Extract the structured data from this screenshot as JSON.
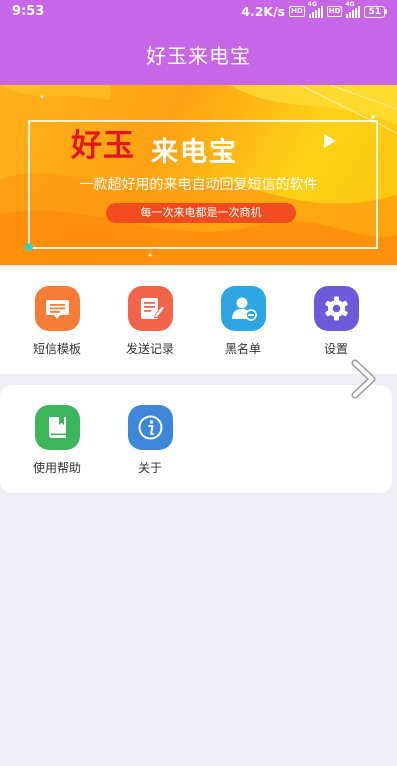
{
  "status_bar": {
    "time": "9:53",
    "net_speed": "4.2K/s",
    "hd_tag": "HD",
    "network_gen": "4G",
    "battery_level": "51"
  },
  "app_bar": {
    "title": "好玉来电宝"
  },
  "banner": {
    "title_part1": "好玉",
    "title_part2": "来电宝",
    "subtitle": "一款超好用的来电自动回复短信的软件",
    "slogan": "每一次来电都是一次商机"
  },
  "menu_primary": [
    {
      "label": "短信模板",
      "icon": "sms-template-icon",
      "color": "#f57c36"
    },
    {
      "label": "发送记录",
      "icon": "send-record-icon",
      "color": "#f2644a"
    },
    {
      "label": "黑名单",
      "icon": "blacklist-icon",
      "color": "#2ea6e4"
    },
    {
      "label": "设置",
      "icon": "gear-icon",
      "color": "#6b5bd9"
    }
  ],
  "menu_secondary": [
    {
      "label": "使用帮助",
      "icon": "help-book-icon",
      "color": "#3db55c"
    },
    {
      "label": "关于",
      "icon": "info-icon",
      "color": "#3e86d8"
    }
  ],
  "colors": {
    "app_bar": "#c766e6",
    "page_bg": "#efeef4"
  }
}
